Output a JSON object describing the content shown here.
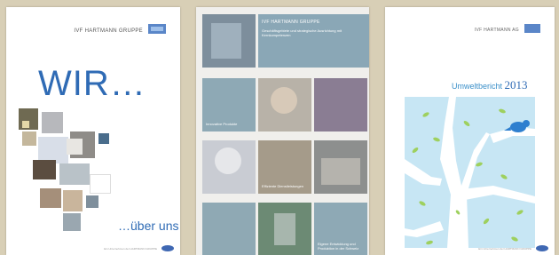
{
  "cover1": {
    "brand": "IVF HARTMANN GRUPPE",
    "headline": "WIR…",
    "subline": "…über uns",
    "footer_text": "Ein Unternehmen der HARTMANN GRUPPE"
  },
  "cover2": {
    "hero": {
      "title": "IVF HARTMANN GRUPPE",
      "text": "Geschäftsgebiete und strategische Ausrichtung mit Kernkompetenzen"
    },
    "tiles": [
      {
        "name": "tile-innovative-produkte",
        "label": "Innovative Produkte",
        "color": "#8ea9b5"
      },
      {
        "name": "tile-effiziente-dienstleistungen",
        "label": "Effiziente Dienstleistungen",
        "color": "#a59b8a"
      },
      {
        "name": "tile-entwicklung-produktion",
        "label": "Eigene Entwicklung und Produktion in der Schweiz",
        "color": "#8ea9b5"
      }
    ]
  },
  "cover3": {
    "brand": "IVF HARTMANN AG",
    "report_label": "Umweltbericht",
    "report_year": "2013",
    "footer_text": "Ein Unternehmen der HARTMANN GRUPPE"
  }
}
